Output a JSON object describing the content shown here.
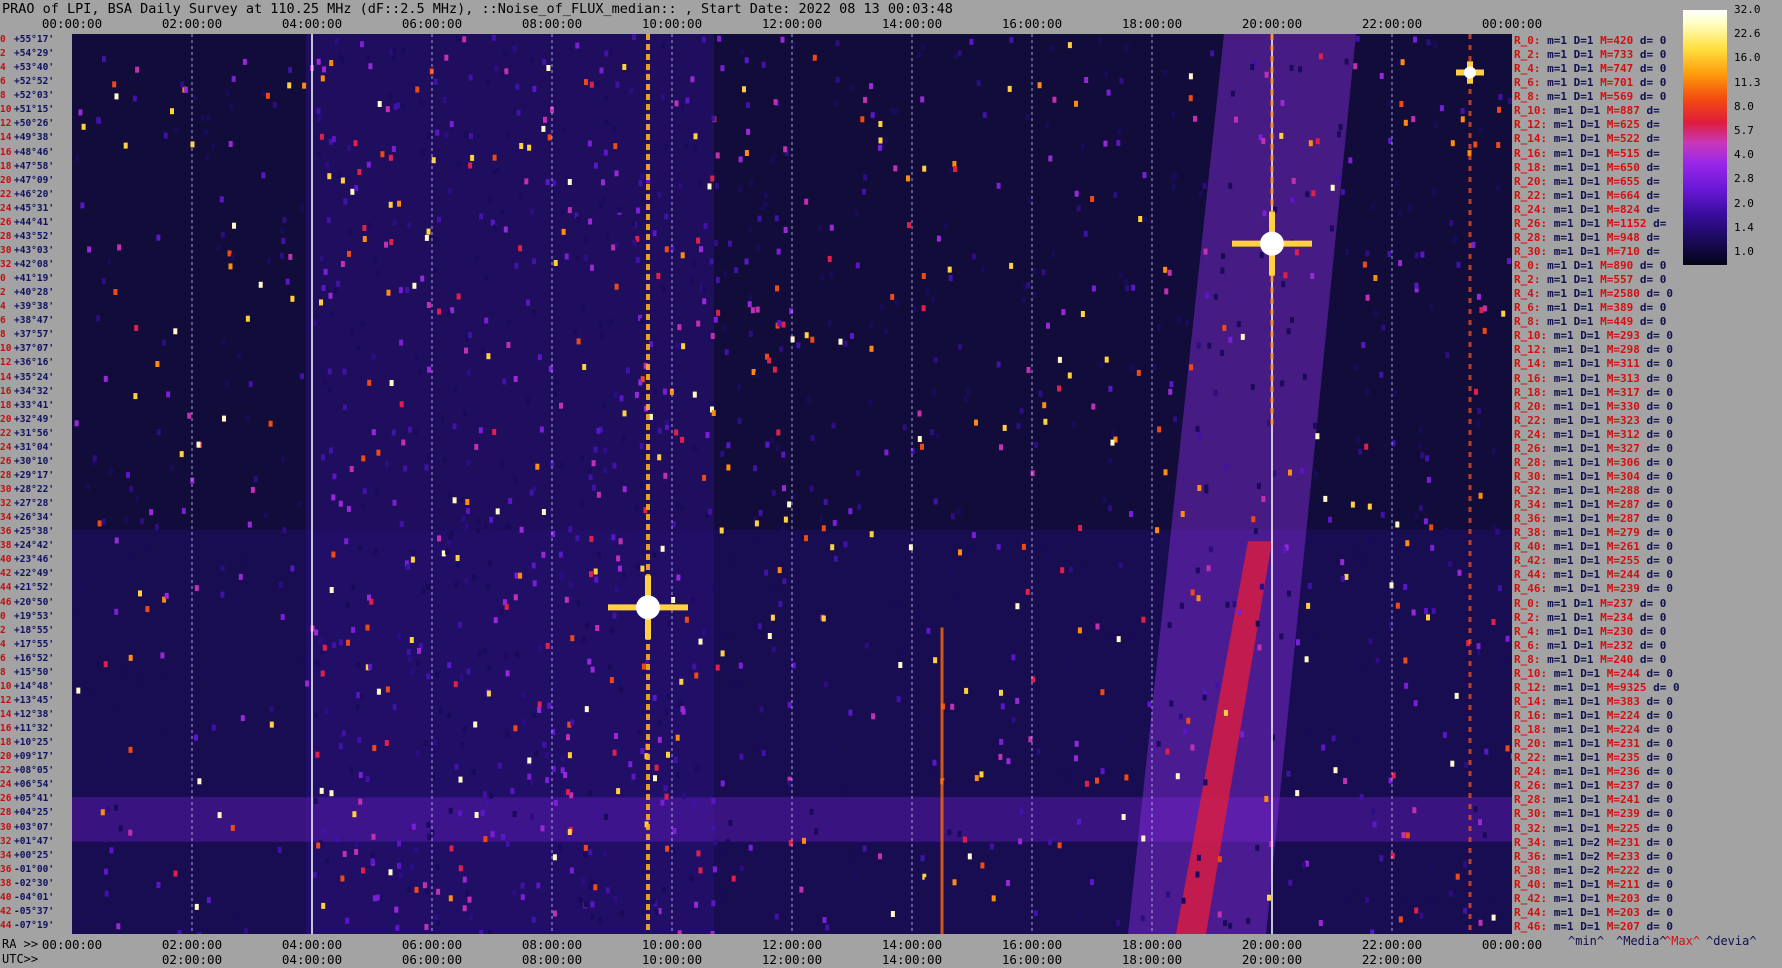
{
  "title": "PRAO of LPI, BSA Daily Survey at 110.25 MHz (dF::2.5 MHz), ::Noise_of_FLUX_median:: , Start Date: 2022 08 13 00:03:48",
  "top_axis": [
    "00:00:00",
    "02:00:00",
    "04:00:00",
    "06:00:00",
    "08:00:00",
    "10:00:00",
    "12:00:00",
    "14:00:00",
    "16:00:00",
    "18:00:00",
    "20:00:00",
    "22:00:00",
    "00:00:00"
  ],
  "ra_prefix": "RA >>",
  "ra_axis": [
    "00:00:00",
    "02:00:00",
    "04:00:00",
    "06:00:00",
    "08:00:00",
    "10:00:00",
    "12:00:00",
    "14:00:00",
    "16:00:00",
    "18:00:00",
    "20:00:00",
    "22:00:00",
    "00:00:00"
  ],
  "utc_prefix": "UTC>>",
  "utc_axis": [
    "02:00:00",
    "04:00:00",
    "06:00:00",
    "08:00:00",
    "10:00:00",
    "12:00:00",
    "14:00:00",
    "16:00:00",
    "18:00:00",
    "20:00:00",
    "22:00:00"
  ],
  "dec_rows": [
    {
      "i": "0",
      "d": "+55°17'"
    },
    {
      "i": "2",
      "d": "+54°29'"
    },
    {
      "i": "4",
      "d": "+53°40'"
    },
    {
      "i": "6",
      "d": "+52°52'"
    },
    {
      "i": "8",
      "d": "+52°03'"
    },
    {
      "i": "10",
      "d": "+51°15'"
    },
    {
      "i": "12",
      "d": "+50°26'"
    },
    {
      "i": "14",
      "d": "+49°38'"
    },
    {
      "i": "16",
      "d": "+48°46'"
    },
    {
      "i": "18",
      "d": "+47°58'"
    },
    {
      "i": "20",
      "d": "+47°09'"
    },
    {
      "i": "22",
      "d": "+46°20'"
    },
    {
      "i": "24",
      "d": "+45°31'"
    },
    {
      "i": "26",
      "d": "+44°41'"
    },
    {
      "i": "28",
      "d": "+43°52'"
    },
    {
      "i": "30",
      "d": "+43°03'"
    },
    {
      "i": "32",
      "d": "+42°08'"
    },
    {
      "i": "0",
      "d": "+41°19'"
    },
    {
      "i": "2",
      "d": "+40°28'"
    },
    {
      "i": "4",
      "d": "+39°38'"
    },
    {
      "i": "6",
      "d": "+38°47'"
    },
    {
      "i": "8",
      "d": "+37°57'"
    },
    {
      "i": "10",
      "d": "+37°07'"
    },
    {
      "i": "12",
      "d": "+36°16'"
    },
    {
      "i": "14",
      "d": "+35°24'"
    },
    {
      "i": "16",
      "d": "+34°32'"
    },
    {
      "i": "18",
      "d": "+33°41'"
    },
    {
      "i": "20",
      "d": "+32°49'"
    },
    {
      "i": "22",
      "d": "+31°56'"
    },
    {
      "i": "24",
      "d": "+31°04'"
    },
    {
      "i": "26",
      "d": "+30°10'"
    },
    {
      "i": "28",
      "d": "+29°17'"
    },
    {
      "i": "30",
      "d": "+28°22'"
    },
    {
      "i": "32",
      "d": "+27°28'"
    },
    {
      "i": "34",
      "d": "+26°34'"
    },
    {
      "i": "36",
      "d": "+25°38'"
    },
    {
      "i": "38",
      "d": "+24°42'"
    },
    {
      "i": "40",
      "d": "+23°46'"
    },
    {
      "i": "42",
      "d": "+22°49'"
    },
    {
      "i": "44",
      "d": "+21°52'"
    },
    {
      "i": "46",
      "d": "+20°50'"
    },
    {
      "i": "0",
      "d": "+19°53'"
    },
    {
      "i": "2",
      "d": "+18°55'"
    },
    {
      "i": "4",
      "d": "+17°55'"
    },
    {
      "i": "6",
      "d": "+16°52'"
    },
    {
      "i": "8",
      "d": "+15°50'"
    },
    {
      "i": "10",
      "d": "+14°48'"
    },
    {
      "i": "12",
      "d": "+13°45'"
    },
    {
      "i": "14",
      "d": "+12°38'"
    },
    {
      "i": "16",
      "d": "+11°32'"
    },
    {
      "i": "18",
      "d": "+10°25'"
    },
    {
      "i": "20",
      "d": "+09°17'"
    },
    {
      "i": "22",
      "d": "+08°05'"
    },
    {
      "i": "24",
      "d": "+06°54'"
    },
    {
      "i": "26",
      "d": "+05°41'"
    },
    {
      "i": "28",
      "d": "+04°25'"
    },
    {
      "i": "30",
      "d": "+03°07'"
    },
    {
      "i": "32",
      "d": "+01°47'"
    },
    {
      "i": "34",
      "d": "+00°25'"
    },
    {
      "i": "36",
      "d": "-01°00'"
    },
    {
      "i": "38",
      "d": "-02°30'"
    },
    {
      "i": "40",
      "d": "-04°01'"
    },
    {
      "i": "42",
      "d": "-05°37'"
    },
    {
      "i": "44",
      "d": "-07°19'"
    }
  ],
  "stats": [
    {
      "r": "R_0:",
      "m": "1",
      "d": "1",
      "M": "420",
      "de": "0"
    },
    {
      "r": "R_2:",
      "m": "1",
      "d": "1",
      "M": "733",
      "de": "0"
    },
    {
      "r": "R_4:",
      "m": "1",
      "d": "1",
      "M": "747",
      "de": "0"
    },
    {
      "r": "R_6:",
      "m": "1",
      "d": "1",
      "M": "701",
      "de": "0"
    },
    {
      "r": "R_8:",
      "m": "1",
      "d": "1",
      "M": "569",
      "de": "0"
    },
    {
      "r": "R_10:",
      "m": "1",
      "d": "1",
      "M": "887",
      "de": ""
    },
    {
      "r": "R_12:",
      "m": "1",
      "d": "1",
      "M": "625",
      "de": ""
    },
    {
      "r": "R_14:",
      "m": "1",
      "d": "1",
      "M": "522",
      "de": ""
    },
    {
      "r": "R_16:",
      "m": "1",
      "d": "1",
      "M": "515",
      "de": ""
    },
    {
      "r": "R_18:",
      "m": "1",
      "d": "1",
      "M": "650",
      "de": ""
    },
    {
      "r": "R_20:",
      "m": "1",
      "d": "1",
      "M": "655",
      "de": ""
    },
    {
      "r": "R_22:",
      "m": "1",
      "d": "1",
      "M": "664",
      "de": ""
    },
    {
      "r": "R_24:",
      "m": "1",
      "d": "1",
      "M": "824",
      "de": ""
    },
    {
      "r": "R_26:",
      "m": "1",
      "d": "1",
      "M": "1152",
      "de": ""
    },
    {
      "r": "R_28:",
      "m": "1",
      "d": "1",
      "M": "948",
      "de": ""
    },
    {
      "r": "R_30:",
      "m": "1",
      "d": "1",
      "M": "710",
      "de": ""
    },
    {
      "r": "R_0:",
      "m": "1",
      "d": "1",
      "M": "890",
      "de": "0"
    },
    {
      "r": "R_2:",
      "m": "1",
      "d": "1",
      "M": "557",
      "de": "0"
    },
    {
      "r": "R_4:",
      "m": "1",
      "d": "1",
      "M": "2580",
      "de": "0"
    },
    {
      "r": "R_6:",
      "m": "1",
      "d": "1",
      "M": "389",
      "de": "0"
    },
    {
      "r": "R_8:",
      "m": "1",
      "d": "1",
      "M": "449",
      "de": "0"
    },
    {
      "r": "R_10:",
      "m": "1",
      "d": "1",
      "M": "293",
      "de": "0"
    },
    {
      "r": "R_12:",
      "m": "1",
      "d": "1",
      "M": "298",
      "de": "0"
    },
    {
      "r": "R_14:",
      "m": "1",
      "d": "1",
      "M": "311",
      "de": "0"
    },
    {
      "r": "R_16:",
      "m": "1",
      "d": "1",
      "M": "313",
      "de": "0"
    },
    {
      "r": "R_18:",
      "m": "1",
      "d": "1",
      "M": "317",
      "de": "0"
    },
    {
      "r": "R_20:",
      "m": "1",
      "d": "1",
      "M": "330",
      "de": "0"
    },
    {
      "r": "R_22:",
      "m": "1",
      "d": "1",
      "M": "323",
      "de": "0"
    },
    {
      "r": "R_24:",
      "m": "1",
      "d": "1",
      "M": "312",
      "de": "0"
    },
    {
      "r": "R_26:",
      "m": "1",
      "d": "1",
      "M": "327",
      "de": "0"
    },
    {
      "r": "R_28:",
      "m": "1",
      "d": "1",
      "M": "306",
      "de": "0"
    },
    {
      "r": "R_30:",
      "m": "1",
      "d": "1",
      "M": "304",
      "de": "0"
    },
    {
      "r": "R_32:",
      "m": "1",
      "d": "1",
      "M": "288",
      "de": "0"
    },
    {
      "r": "R_34:",
      "m": "1",
      "d": "1",
      "M": "287",
      "de": "0"
    },
    {
      "r": "R_36:",
      "m": "1",
      "d": "1",
      "M": "287",
      "de": "0"
    },
    {
      "r": "R_38:",
      "m": "1",
      "d": "1",
      "M": "279",
      "de": "0"
    },
    {
      "r": "R_40:",
      "m": "1",
      "d": "1",
      "M": "261",
      "de": "0"
    },
    {
      "r": "R_42:",
      "m": "1",
      "d": "1",
      "M": "255",
      "de": "0"
    },
    {
      "r": "R_44:",
      "m": "1",
      "d": "1",
      "M": "244",
      "de": "0"
    },
    {
      "r": "R_46:",
      "m": "1",
      "d": "1",
      "M": "239",
      "de": "0"
    },
    {
      "r": "R_0:",
      "m": "1",
      "d": "1",
      "M": "237",
      "de": "0"
    },
    {
      "r": "R_2:",
      "m": "1",
      "d": "1",
      "M": "234",
      "de": "0"
    },
    {
      "r": "R_4:",
      "m": "1",
      "d": "1",
      "M": "230",
      "de": "0"
    },
    {
      "r": "R_6:",
      "m": "1",
      "d": "1",
      "M": "232",
      "de": "0"
    },
    {
      "r": "R_8:",
      "m": "1",
      "d": "1",
      "M": "240",
      "de": "0"
    },
    {
      "r": "R_10:",
      "m": "1",
      "d": "1",
      "M": "244",
      "de": "0"
    },
    {
      "r": "R_12:",
      "m": "1",
      "d": "1",
      "M": "9325",
      "de": "0"
    },
    {
      "r": "R_14:",
      "m": "1",
      "d": "1",
      "M": "383",
      "de": "0"
    },
    {
      "r": "R_16:",
      "m": "1",
      "d": "1",
      "M": "224",
      "de": "0"
    },
    {
      "r": "R_18:",
      "m": "1",
      "d": "1",
      "M": "224",
      "de": "0"
    },
    {
      "r": "R_20:",
      "m": "1",
      "d": "1",
      "M": "231",
      "de": "0"
    },
    {
      "r": "R_22:",
      "m": "1",
      "d": "1",
      "M": "235",
      "de": "0"
    },
    {
      "r": "R_24:",
      "m": "1",
      "d": "1",
      "M": "236",
      "de": "0"
    },
    {
      "r": "R_26:",
      "m": "1",
      "d": "1",
      "M": "237",
      "de": "0"
    },
    {
      "r": "R_28:",
      "m": "1",
      "d": "1",
      "M": "241",
      "de": "0"
    },
    {
      "r": "R_30:",
      "m": "1",
      "d": "1",
      "M": "239",
      "de": "0"
    },
    {
      "r": "R_32:",
      "m": "1",
      "d": "1",
      "M": "225",
      "de": "0"
    },
    {
      "r": "R_34:",
      "m": "1",
      "d": "2",
      "M": "231",
      "de": "0"
    },
    {
      "r": "R_36:",
      "m": "1",
      "d": "2",
      "M": "233",
      "de": "0"
    },
    {
      "r": "R_38:",
      "m": "1",
      "d": "2",
      "M": "222",
      "de": "0"
    },
    {
      "r": "R_40:",
      "m": "1",
      "d": "1",
      "M": "211",
      "de": "0"
    },
    {
      "r": "R_42:",
      "m": "1",
      "d": "1",
      "M": "203",
      "de": "0"
    },
    {
      "r": "R_44:",
      "m": "1",
      "d": "1",
      "M": "203",
      "de": "0"
    },
    {
      "r": "R_46:",
      "m": "1",
      "d": "1",
      "M": "207",
      "de": "0"
    }
  ],
  "legend": {
    "min": "^min^",
    "median": "^Media^",
    "max": "^Max^",
    "devia": "^devia^"
  },
  "colorbar_ticks": [
    "32.0",
    "22.6",
    "16.0",
    "11.3",
    "8.0",
    "5.7",
    "4.0",
    "2.8",
    "2.0",
    "1.4",
    "1.0"
  ],
  "colors": {
    "background": "#a3a3a3",
    "plot_bg": "#0b0826",
    "label_red": "#d21010",
    "label_blue": "#101050"
  },
  "chart_data": {
    "type": "heatmap",
    "title": "PRAO of LPI, BSA Daily Survey at 110.25 MHz (dF::2.5 MHz), ::Noise_of_FLUX_median:: , Start Date: 2022 08 13 00:03:48",
    "x_axis_ra": [
      "00:00:00",
      "02:00:00",
      "04:00:00",
      "06:00:00",
      "08:00:00",
      "10:00:00",
      "12:00:00",
      "14:00:00",
      "16:00:00",
      "18:00:00",
      "20:00:00",
      "22:00:00",
      "00:00:00"
    ],
    "y_axis_dec_range": [
      "+55°17'",
      "-07°19'"
    ],
    "colorbar": {
      "min": 1.0,
      "max": 32.0,
      "scale": "log2"
    },
    "bright_sources": [
      {
        "ra_hours": 9.6,
        "dec_deg": 15.4,
        "level": 32
      },
      {
        "ra_hours": 20.0,
        "dec_deg": 40.7,
        "level": 32
      },
      {
        "ra_hours": 23.3,
        "dec_deg": 52.6,
        "level": 22.6
      }
    ],
    "galactic_plane": {
      "ra_hours_start": 18.5,
      "ra_hours_end": 20.5,
      "level": 5.7
    }
  }
}
